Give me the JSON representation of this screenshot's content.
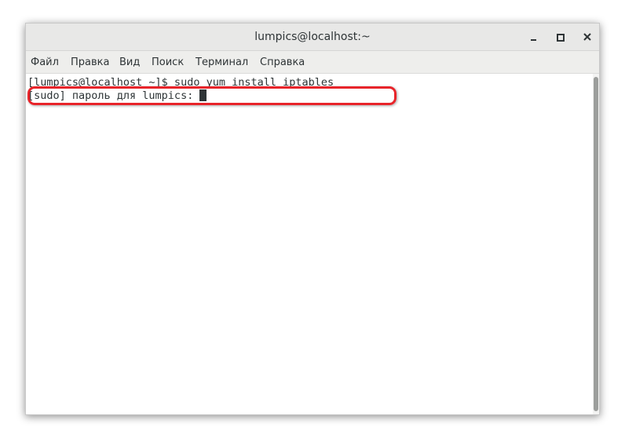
{
  "window": {
    "title": "lumpics@localhost:~"
  },
  "menu": {
    "items": [
      "Файл",
      "Правка",
      "Вид",
      "Поиск",
      "Терминал",
      "Справка"
    ]
  },
  "terminal": {
    "line1": "[lumpics@localhost ~]$ sudo yum install iptables",
    "line2": "[sudo] пароль для lumpics: "
  },
  "colors": {
    "highlight": "#e8242a",
    "text": "#2e3436"
  },
  "icons": {
    "minimize": "minimize-icon",
    "maximize": "maximize-icon",
    "close": "close-icon"
  }
}
